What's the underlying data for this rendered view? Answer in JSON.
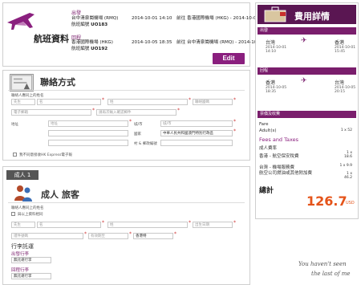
{
  "flight": {
    "title": "航班資料",
    "edit_label": "Edit",
    "outbound": {
      "dir": "出發",
      "from": "台中清泉崗機場 (RMQ)",
      "dep": "2014-10-01 14:10",
      "arrow": "前往",
      "to": "香港國際機場 (HKG) - 2014-10-01 15:45",
      "flight_label": "航班編號",
      "flight_no": "UO183"
    },
    "return": {
      "dir": "回程",
      "from": "香港國際機場 (HKG)",
      "dep": "2014-10-05 18:35",
      "arrow": "前往",
      "to": "台中清泉崗機場 (RMQ) - 2014-10-05 20:15",
      "flight_label": "航班編號",
      "flight_no": "UO192"
    }
  },
  "contact": {
    "title": "聯絡方式",
    "note": "聯絡人應同上的姓名",
    "title_select": "先生",
    "name_ph": "名",
    "surname_ph": "姓",
    "code_ph": "聯絡國碼",
    "phone_ph": "電子郵箱",
    "email_ph": "請再次輸入確認郵件",
    "addr_label": "地址",
    "addr_ph": "地址",
    "city_label": "城/市",
    "city_ph": "城/市",
    "country_label": "國家",
    "country_val": "中華人民共和國澳門特別行政區",
    "zip_label": "村 & 郵政編號",
    "optin": "我不同意接收HK Express電子報"
  },
  "pax": {
    "tag": "成人 1",
    "title": "成人 旅客",
    "note": "聯絡人應同上的姓名",
    "same_as": "與以上資料相同",
    "title_select": "先生",
    "name_ph": "名",
    "surname_ph": "姓",
    "dob_ph": "出生日期",
    "passport_ph": "證件號碼",
    "expiry_ph": "有效期至",
    "nation_val": "香港特",
    "extras_head": "行李託運",
    "out_link": "出發行李",
    "out_select": "無託運行李",
    "ret_link": "回程行李",
    "ret_select": "無託運行李"
  },
  "fare": {
    "title": "費用詳情",
    "out_bar": "出發",
    "out_from": "台灣",
    "out_to": "香港",
    "out_dep": "2014-10-01\n14:10",
    "out_arr": "2014-10-01\n15:45",
    "ret_bar": "回程",
    "ret_from": "香港",
    "ret_to": "台灣",
    "ret_dep": "2014-10-05\n18:35",
    "ret_arr": "2014-10-05\n20:15",
    "sum_bar": "票價及收費",
    "fare_lbl": "Fare",
    "adult_lbl": "Adult(s)",
    "adult_val": "1 x 52",
    "fees_lbl": "Fees and Taxes",
    "fee1": "成人費率",
    "fee2": "香港 - 航空保安稅費",
    "fee2_val": "1 x 18.6",
    "fee3": "台灣 - 機場服務費",
    "fee3_val": "1 x 9.9",
    "fee4": "航空公司燃油或其他附加費",
    "fee4_val": "1 x 46.2",
    "total_lbl": "總計",
    "total_val": "126.7",
    "currency": "USD"
  },
  "caption": {
    "line1": "You haven't seen",
    "line2": "the last of me"
  }
}
